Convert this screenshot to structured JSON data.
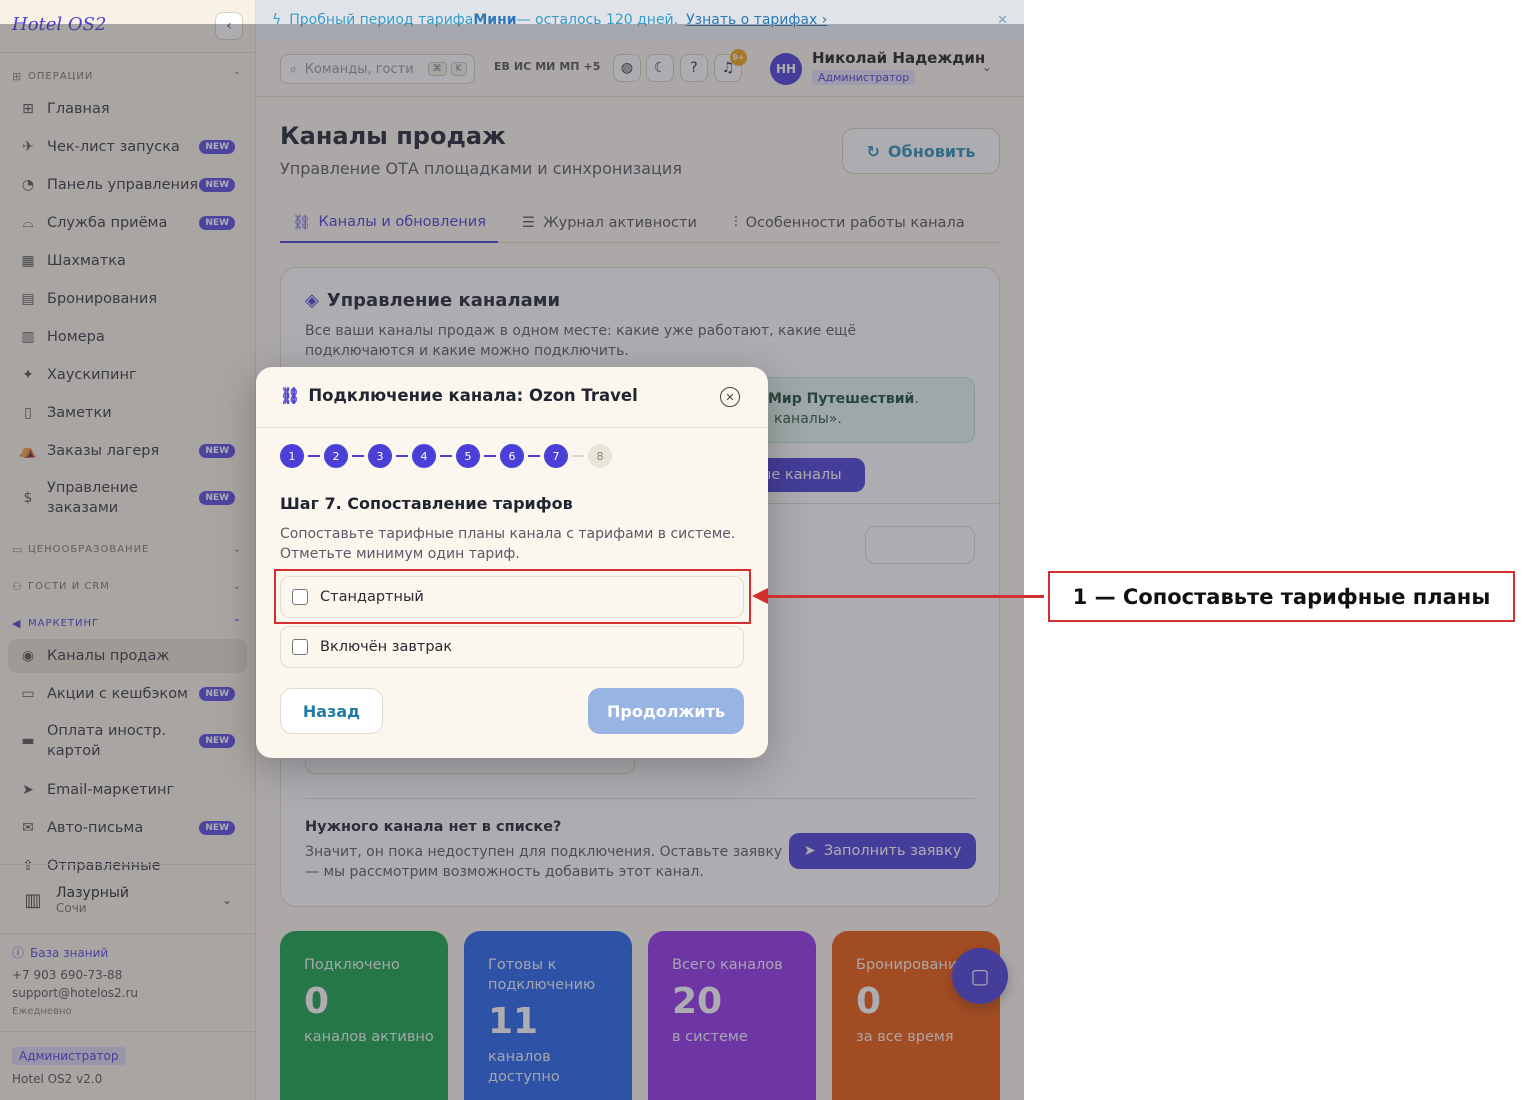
{
  "sidebar": {
    "brand": "Hotel OS2",
    "collapse_icon": "chevron-left-icon",
    "sections": {
      "operations": "ОПЕРАЦИИ",
      "pricing": "ЦЕНООБРАЗОВАНИЕ",
      "guests": "ГОСТИ И CRM",
      "marketing": "МАРКЕТИНГ"
    },
    "items": [
      {
        "label": "Главная",
        "icon": "grid-icon",
        "new": false
      },
      {
        "label": "Чек-лист запуска",
        "icon": "rocket-icon",
        "new": true
      },
      {
        "label": "Панель управления",
        "icon": "gauge-icon",
        "new": true
      },
      {
        "label": "Служба приёма",
        "icon": "bell-desk-icon",
        "new": true
      },
      {
        "label": "Шахматка",
        "icon": "table-icon",
        "new": false
      },
      {
        "label": "Бронирования",
        "icon": "clipboard-icon",
        "new": false
      },
      {
        "label": "Номера",
        "icon": "building-icon",
        "new": false
      },
      {
        "label": "Хаускипинг",
        "icon": "sparkles-icon",
        "new": false
      },
      {
        "label": "Заметки",
        "icon": "note-icon",
        "new": false
      },
      {
        "label": "Заказы лагеря",
        "icon": "tent-icon",
        "new": true
      },
      {
        "label": "Управление заказами",
        "icon": "dollar-doc-icon",
        "new": true
      }
    ],
    "marketing_items": [
      {
        "label": "Каналы продаж",
        "icon": "broadcast-icon",
        "new": false
      },
      {
        "label": "Акции с кешбэком",
        "icon": "wallet-icon",
        "new": true
      },
      {
        "label": "Оплата иностр. картой",
        "icon": "card-icon",
        "new": true
      },
      {
        "label": "Email-маркетинг",
        "icon": "send-icon",
        "new": false
      },
      {
        "label": "Авто-письма",
        "icon": "mail-icon",
        "new": true
      },
      {
        "label": "Отправленные",
        "icon": "outbox-icon",
        "new": false
      }
    ],
    "new_badge": "NEW",
    "hotel": {
      "name": "Лазурный",
      "city": "Сочи"
    },
    "knowledge_base": "База знаний",
    "phone": "+7 903 690-73-88",
    "email": "support@hotelos2.ru",
    "schedule": "Ежедневно",
    "role": "Администратор",
    "version": "Hotel OS2 v2.0"
  },
  "banner": {
    "prefix": "Пробный период тарифа ",
    "plan": "Мини",
    "suffix": " — осталось 120 дней.",
    "link": "Узнать о тарифах ›",
    "close": "✕"
  },
  "topbar": {
    "search_placeholder": "Команды, гости",
    "kbd1": "⌘",
    "kbd2": "K",
    "langs": [
      "ЕВ",
      "ИС",
      "МИ",
      "МП",
      "+5"
    ],
    "notif_count": "9+",
    "avatar": "НН",
    "user_name": "Николай Надеждин",
    "user_role": "Администратор"
  },
  "page": {
    "title": "Каналы продаж",
    "subtitle": "Управление ОТА площадками и синхронизация",
    "refresh": "Обновить",
    "tabs": [
      "Каналы и обновления",
      "Журнал активности",
      "Особенности работы канала"
    ],
    "card_title": "Управление каналами",
    "card_desc": "Все ваши каналы продаж в одном месте: какие уже работают, какие ещё подключаются и какие можно подключить.",
    "info_bold": "Мир Путешествий",
    "info_line1_end": ".",
    "info_line2": "каналы».",
    "connect_btn": "ные каналы",
    "need_title": "Нужного канала нет в списке?",
    "need_desc": "Значит, он пока недоступен для подключения. Оставьте заявку — мы рассмотрим возможность добавить этот канал.",
    "apply_btn": "Заполнить заявку"
  },
  "stats": [
    {
      "label": "Подключено",
      "value": "0",
      "caption": "каналов активно",
      "color": "#16a34a"
    },
    {
      "label": "Готовы к подключению",
      "value": "11",
      "caption": "каналов доступно",
      "color": "#2563eb"
    },
    {
      "label": "Всего каналов",
      "value": "20",
      "caption": "в системе",
      "color": "#9333ea"
    },
    {
      "label": "Бронирования",
      "value": "0",
      "caption": "за все время",
      "color": "#ea580c"
    }
  ],
  "modal": {
    "title": "Подключение канала: Ozon Travel",
    "steps": [
      "1",
      "2",
      "3",
      "4",
      "5",
      "6",
      "7",
      "8"
    ],
    "current_step": 7,
    "step_title": "Шаг 7. Сопоставление тарифов",
    "step_desc": "Сопоставьте тарифные планы канала с тарифами в системе. Отметьте минимум один тариф.",
    "tariffs": [
      "Стандартный",
      "Включён завтрак"
    ],
    "back": "Назад",
    "next": "Продолжить"
  },
  "annotation": {
    "label": "1 — Сопоставьте тарифные планы"
  }
}
